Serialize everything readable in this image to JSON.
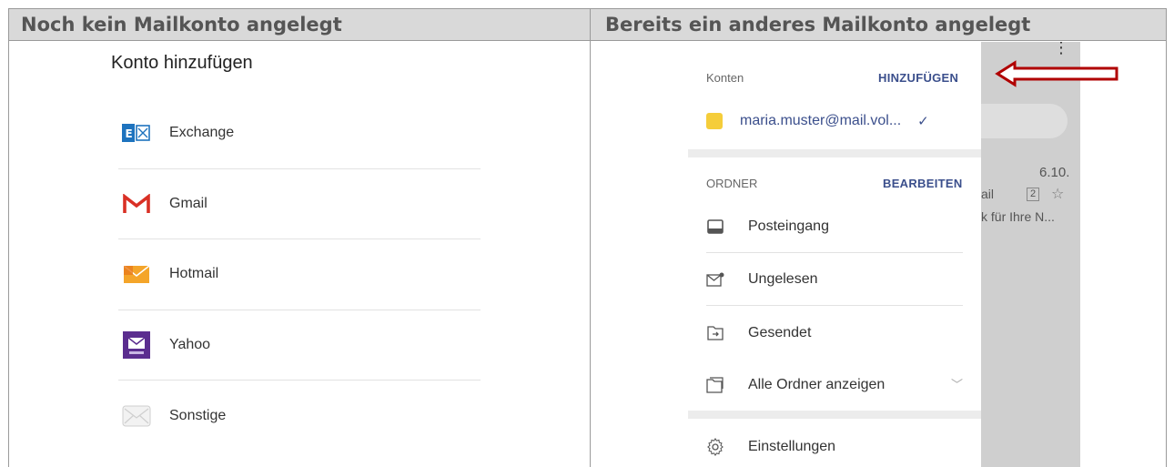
{
  "headers": {
    "left": "Noch kein Mailkonto angelegt",
    "right": "Bereits ein anderes Mailkonto angelegt"
  },
  "left_panel": {
    "title": "Konto hinzufügen",
    "accounts": [
      {
        "label": "Exchange",
        "icon": "exchange-icon"
      },
      {
        "label": "Gmail",
        "icon": "gmail-icon"
      },
      {
        "label": "Hotmail",
        "icon": "hotmail-icon"
      },
      {
        "label": "Yahoo",
        "icon": "yahoo-icon"
      },
      {
        "label": "Sonstige",
        "icon": "mail-envelope-icon"
      }
    ]
  },
  "right_panel": {
    "accounts_label": "Konten",
    "add_action": "HINZUFÜGEN",
    "account_email": "maria.muster@mail.vol...",
    "check": "✓",
    "folders_label": "ORDNER",
    "edit_action": "BEARBEITEN",
    "folders": [
      {
        "label": "Posteingang",
        "icon": "inbox-icon"
      },
      {
        "label": "Ungelesen",
        "icon": "unread-mail-icon"
      },
      {
        "label": "Gesendet",
        "icon": "sent-icon"
      },
      {
        "label": "Alle Ordner anzeigen",
        "icon": "folders-icon"
      }
    ],
    "settings": {
      "label": "Einstellungen",
      "icon": "gear-icon"
    },
    "background": {
      "date": "6.10.",
      "partial_name": "ail",
      "count_badge": "2",
      "preview": "k für Ihre N..."
    }
  },
  "colors": {
    "header_bg": "#d9d9d9",
    "accent_blue": "#3b4f8c",
    "account_color": "#f5cd3a",
    "arrow_red": "#b00000"
  }
}
